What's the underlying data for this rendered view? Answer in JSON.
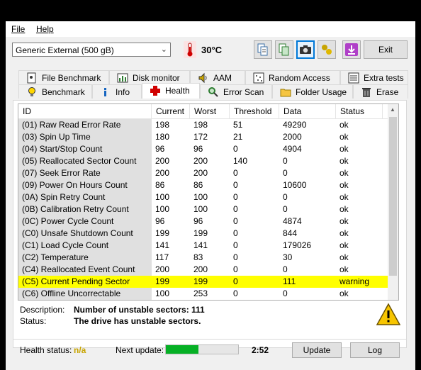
{
  "menu": {
    "file": "File",
    "help": "Help"
  },
  "toolbar": {
    "drive": "Generic External (500 gB)",
    "temperature": "30°C",
    "exit_label": "Exit"
  },
  "tabs_top": [
    {
      "label": "File Benchmark",
      "icon": "file-benchmark-icon"
    },
    {
      "label": "Disk monitor",
      "icon": "disk-monitor-icon"
    },
    {
      "label": "AAM",
      "icon": "speaker-icon"
    },
    {
      "label": "Random Access",
      "icon": "random-access-icon"
    },
    {
      "label": "Extra tests",
      "icon": "extra-tests-icon"
    }
  ],
  "tabs_bottom": [
    {
      "label": "Benchmark",
      "icon": "lightbulb-icon"
    },
    {
      "label": "Info",
      "icon": "info-icon"
    },
    {
      "label": "Health",
      "icon": "health-cross-icon"
    },
    {
      "label": "Error Scan",
      "icon": "magnifier-icon"
    },
    {
      "label": "Folder Usage",
      "icon": "folder-icon"
    },
    {
      "label": "Erase",
      "icon": "trash-icon"
    }
  ],
  "table": {
    "headers": [
      "ID",
      "Current",
      "Worst",
      "Threshold",
      "Data",
      "Status"
    ],
    "rows": [
      [
        "(01) Raw Read Error Rate",
        "198",
        "198",
        "51",
        "49290",
        "ok"
      ],
      [
        "(03) Spin Up Time",
        "180",
        "172",
        "21",
        "2000",
        "ok"
      ],
      [
        "(04) Start/Stop Count",
        "96",
        "96",
        "0",
        "4904",
        "ok"
      ],
      [
        "(05) Reallocated Sector Count",
        "200",
        "200",
        "140",
        "0",
        "ok"
      ],
      [
        "(07) Seek Error Rate",
        "200",
        "200",
        "0",
        "0",
        "ok"
      ],
      [
        "(09) Power On Hours Count",
        "86",
        "86",
        "0",
        "10600",
        "ok"
      ],
      [
        "(0A) Spin Retry Count",
        "100",
        "100",
        "0",
        "0",
        "ok"
      ],
      [
        "(0B) Calibration Retry Count",
        "100",
        "100",
        "0",
        "0",
        "ok"
      ],
      [
        "(0C) Power Cycle Count",
        "96",
        "96",
        "0",
        "4874",
        "ok"
      ],
      [
        "(C0) Unsafe Shutdown Count",
        "199",
        "199",
        "0",
        "844",
        "ok"
      ],
      [
        "(C1) Load Cycle Count",
        "141",
        "141",
        "0",
        "179026",
        "ok"
      ],
      [
        "(C2) Temperature",
        "117",
        "83",
        "0",
        "30",
        "ok"
      ],
      [
        "(C4) Reallocated Event Count",
        "200",
        "200",
        "0",
        "0",
        "ok"
      ],
      [
        "(C5) Current Pending Sector",
        "199",
        "199",
        "0",
        "111",
        "warning"
      ],
      [
        "(C6) Offline Uncorrectable",
        "100",
        "253",
        "0",
        "0",
        "ok"
      ]
    ],
    "highlight_row": 13,
    "highlight_color": "#ffff00"
  },
  "details": {
    "description_label": "Description:",
    "description_value": "Number of unstable sectors: 111",
    "status_label": "Status:",
    "status_value": "The drive has unstable sectors."
  },
  "footer": {
    "health_label": "Health status:",
    "health_value": "n/a",
    "health_color": "#c8a400",
    "next_update_label": "Next update:",
    "next_update_time": "2:52",
    "progress_fraction": 0.45,
    "update_label": "Update",
    "log_label": "Log"
  }
}
